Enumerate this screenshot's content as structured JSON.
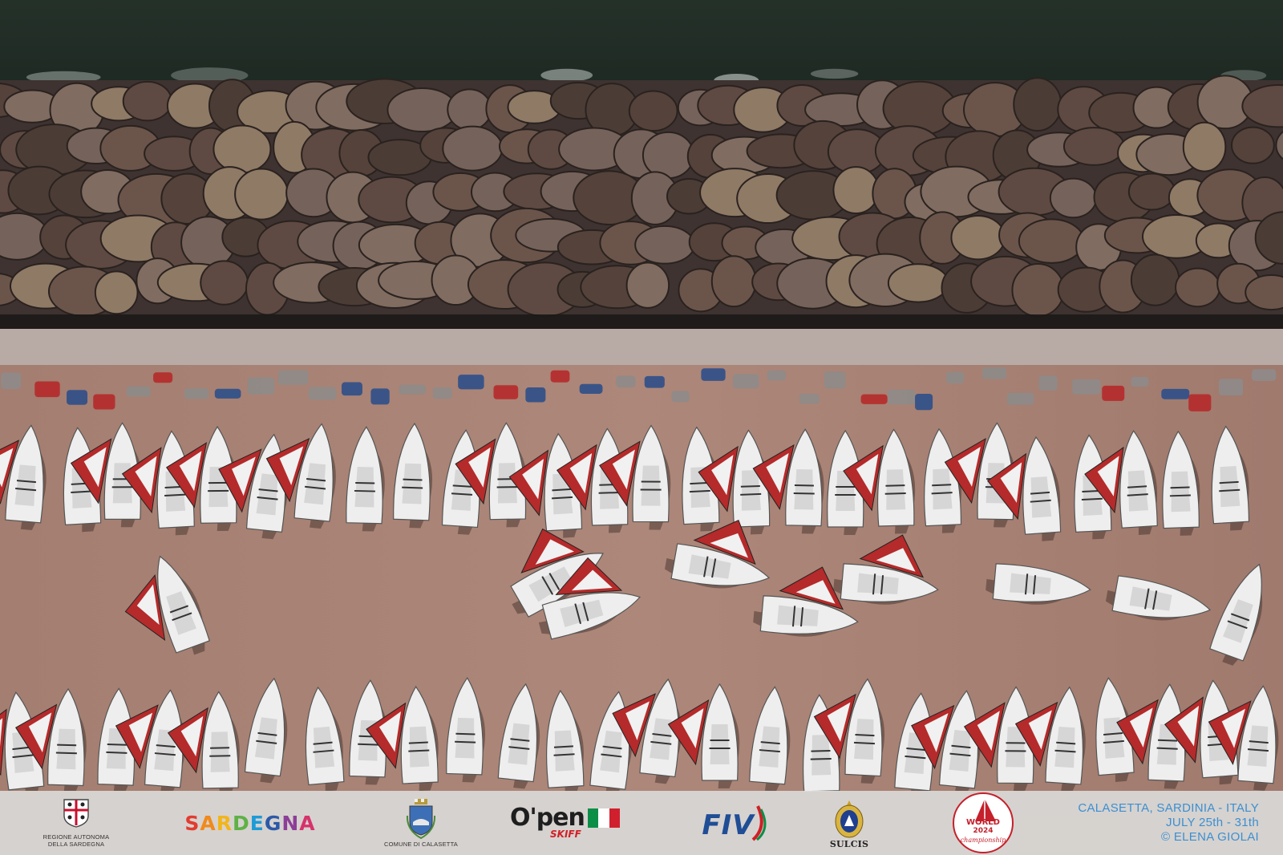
{
  "photo": {
    "subject": "harbour-with-dinghies",
    "colors": {
      "sea": "#1f2a25",
      "rocks": "#5e4a42",
      "pavement": "#a57f72",
      "hull": "#eeeeee",
      "sail_red": "#b52a2a"
    }
  },
  "sponsors": {
    "region": {
      "line1": "REGIONE AUTONOMA",
      "line2": "DELLA SARDEGNA"
    },
    "sardegna": {
      "letters": [
        "S",
        "A",
        "R",
        "D",
        "E",
        "G",
        "N",
        "A"
      ]
    },
    "comune": {
      "label": "COMUNE DI CALASETTA"
    },
    "open_skiff": {
      "word": "O'pen",
      "sub": "SKIFF"
    },
    "fiv": {
      "word": "FIV"
    },
    "sulcis": {
      "label": "SULCIS"
    },
    "worlds": {
      "label": "WORLD",
      "year": "2024",
      "sub": "championship"
    }
  },
  "event": {
    "location": "CALASETTA, SARDINIA - ITALY",
    "dates": "JULY 25th - 31th",
    "credit": "© ELENA GIOLAI"
  }
}
